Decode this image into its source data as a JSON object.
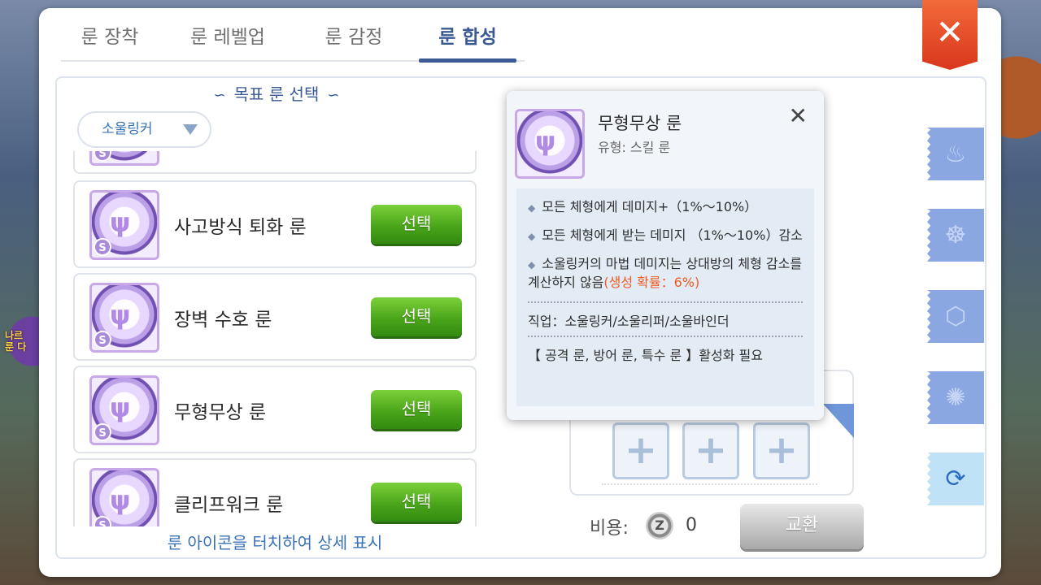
{
  "background": {
    "side_text": [
      "나르",
      "룬 다"
    ]
  },
  "tabs": [
    {
      "label": "룬 장착",
      "active": false
    },
    {
      "label": "룬 레벨업",
      "active": false
    },
    {
      "label": "룬 감정",
      "active": false
    },
    {
      "label": "룬 합성",
      "active": true
    }
  ],
  "close_label": "✕",
  "left": {
    "title": "목표 룬 선택",
    "dropdown": "소울링커",
    "items": [
      {
        "name": "사고방식 퇴화 룬",
        "button": "선택"
      },
      {
        "name": "장벽 수호 룬",
        "button": "선택"
      },
      {
        "name": "무형무상 룬",
        "button": "선택"
      },
      {
        "name": "클리프워크 룬",
        "button": "선택"
      }
    ],
    "hint": "룬 아이콘을 터치하여 상세 표시"
  },
  "right": {
    "plus_symbol": "+",
    "cost_label": "비용:",
    "coin_symbol": "Z",
    "cost_value": "0",
    "exchange_button": "교환"
  },
  "popup": {
    "title": "무형무상 룬",
    "type": "유형: 스킬 룬",
    "close": "✕",
    "effects": [
      "모든 체형에게 데미지+（1%～10%）",
      "모든 체형에게 받는 데미지 （1%～10%）감소"
    ],
    "effect3_main": "소울링커의 마법 데미지는 상대방의 체형 감소를 계산하지 않음",
    "effect3_red": "(생성 확률：6%)",
    "job": "직업：소울링커/소울리퍼/소울바인더",
    "requirement": "【 공격 룬, 방어 룬, 특수 룬 】활성화 필요"
  },
  "icons": {
    "side_tabs": [
      "fire-icon",
      "shield-flame-icon",
      "crest-icon",
      "dice-icon",
      "exchange-icon"
    ]
  },
  "colors": {
    "accent": "#3a5a94",
    "select_button": "#4aa51a",
    "close_button": "#d9361c",
    "probability_red": "#ee5a22"
  }
}
